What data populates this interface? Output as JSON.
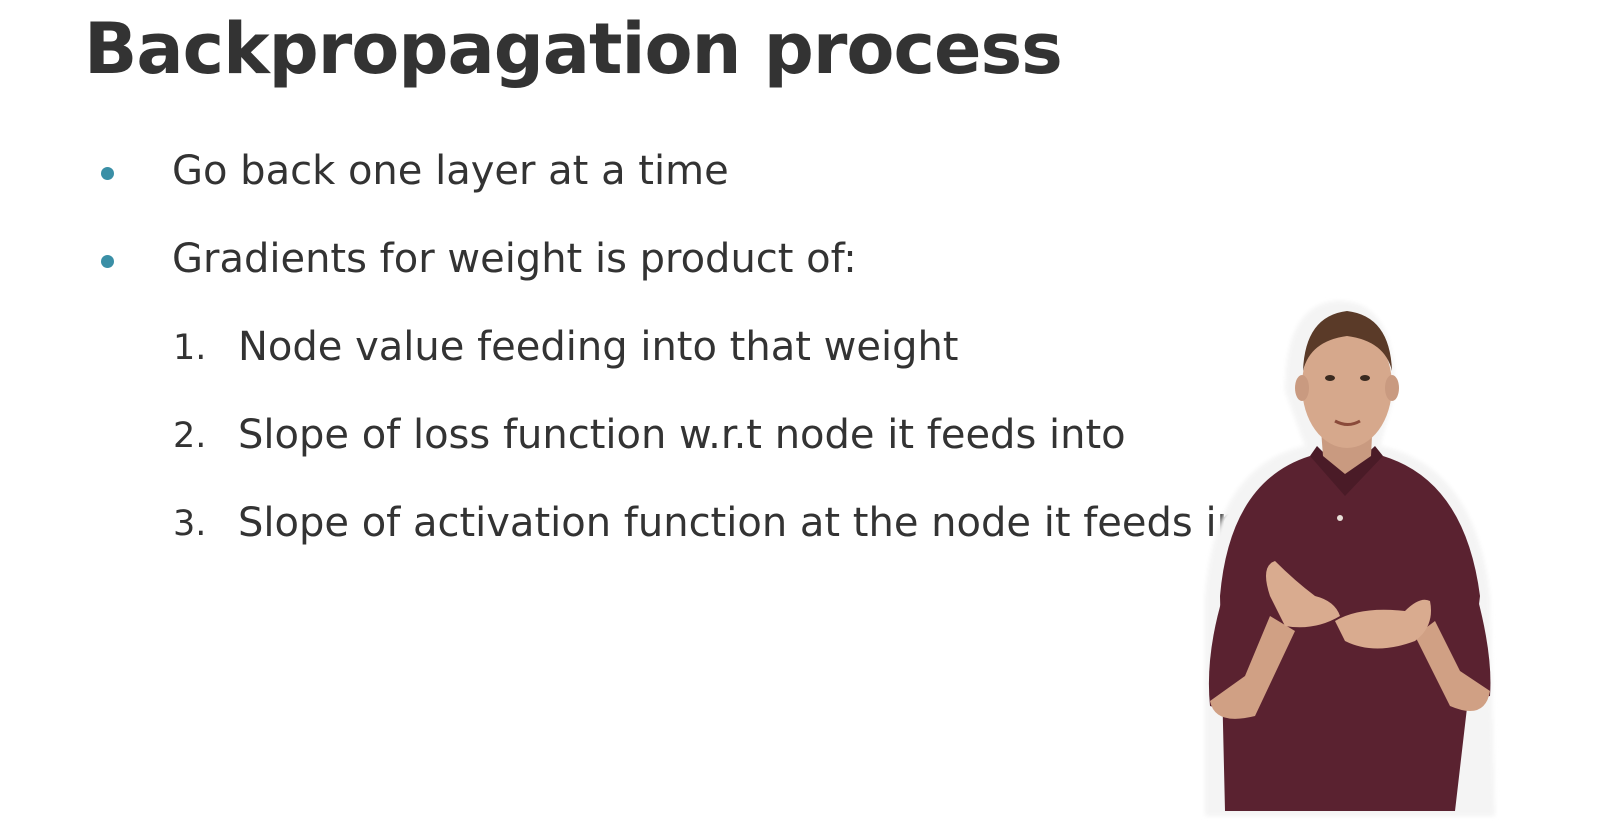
{
  "slide": {
    "title": "Backpropagation process",
    "bullets": [
      "Go back one layer at a time",
      "Gradients for weight is product of:"
    ],
    "numbered": [
      {
        "marker": "1.",
        "text": "Node value feeding into that weight"
      },
      {
        "marker": "2.",
        "text": "Slope of loss function w.r.t node it feeds into"
      },
      {
        "marker": "3.",
        "text": "Slope of activation function at the node it feeds into"
      }
    ],
    "colors": {
      "bullet": "#3a8fa6",
      "text": "#333333",
      "background": "#ffffff"
    }
  },
  "presenter": {
    "shirt_color": "#5a2230"
  }
}
